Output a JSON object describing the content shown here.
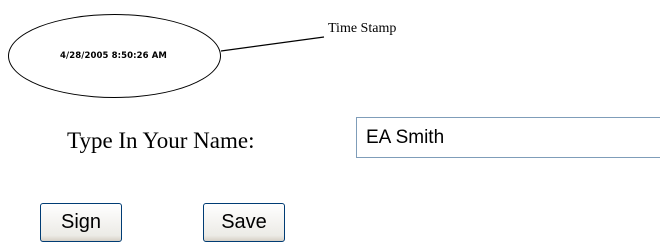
{
  "timestamp": {
    "value": "4/28/2005  8:50:26 AM",
    "label": "Time Stamp"
  },
  "name_field": {
    "label": "Type In Your Name:",
    "value": "EA Smith"
  },
  "buttons": {
    "sign_label": "Sign",
    "save_label": "Save"
  }
}
